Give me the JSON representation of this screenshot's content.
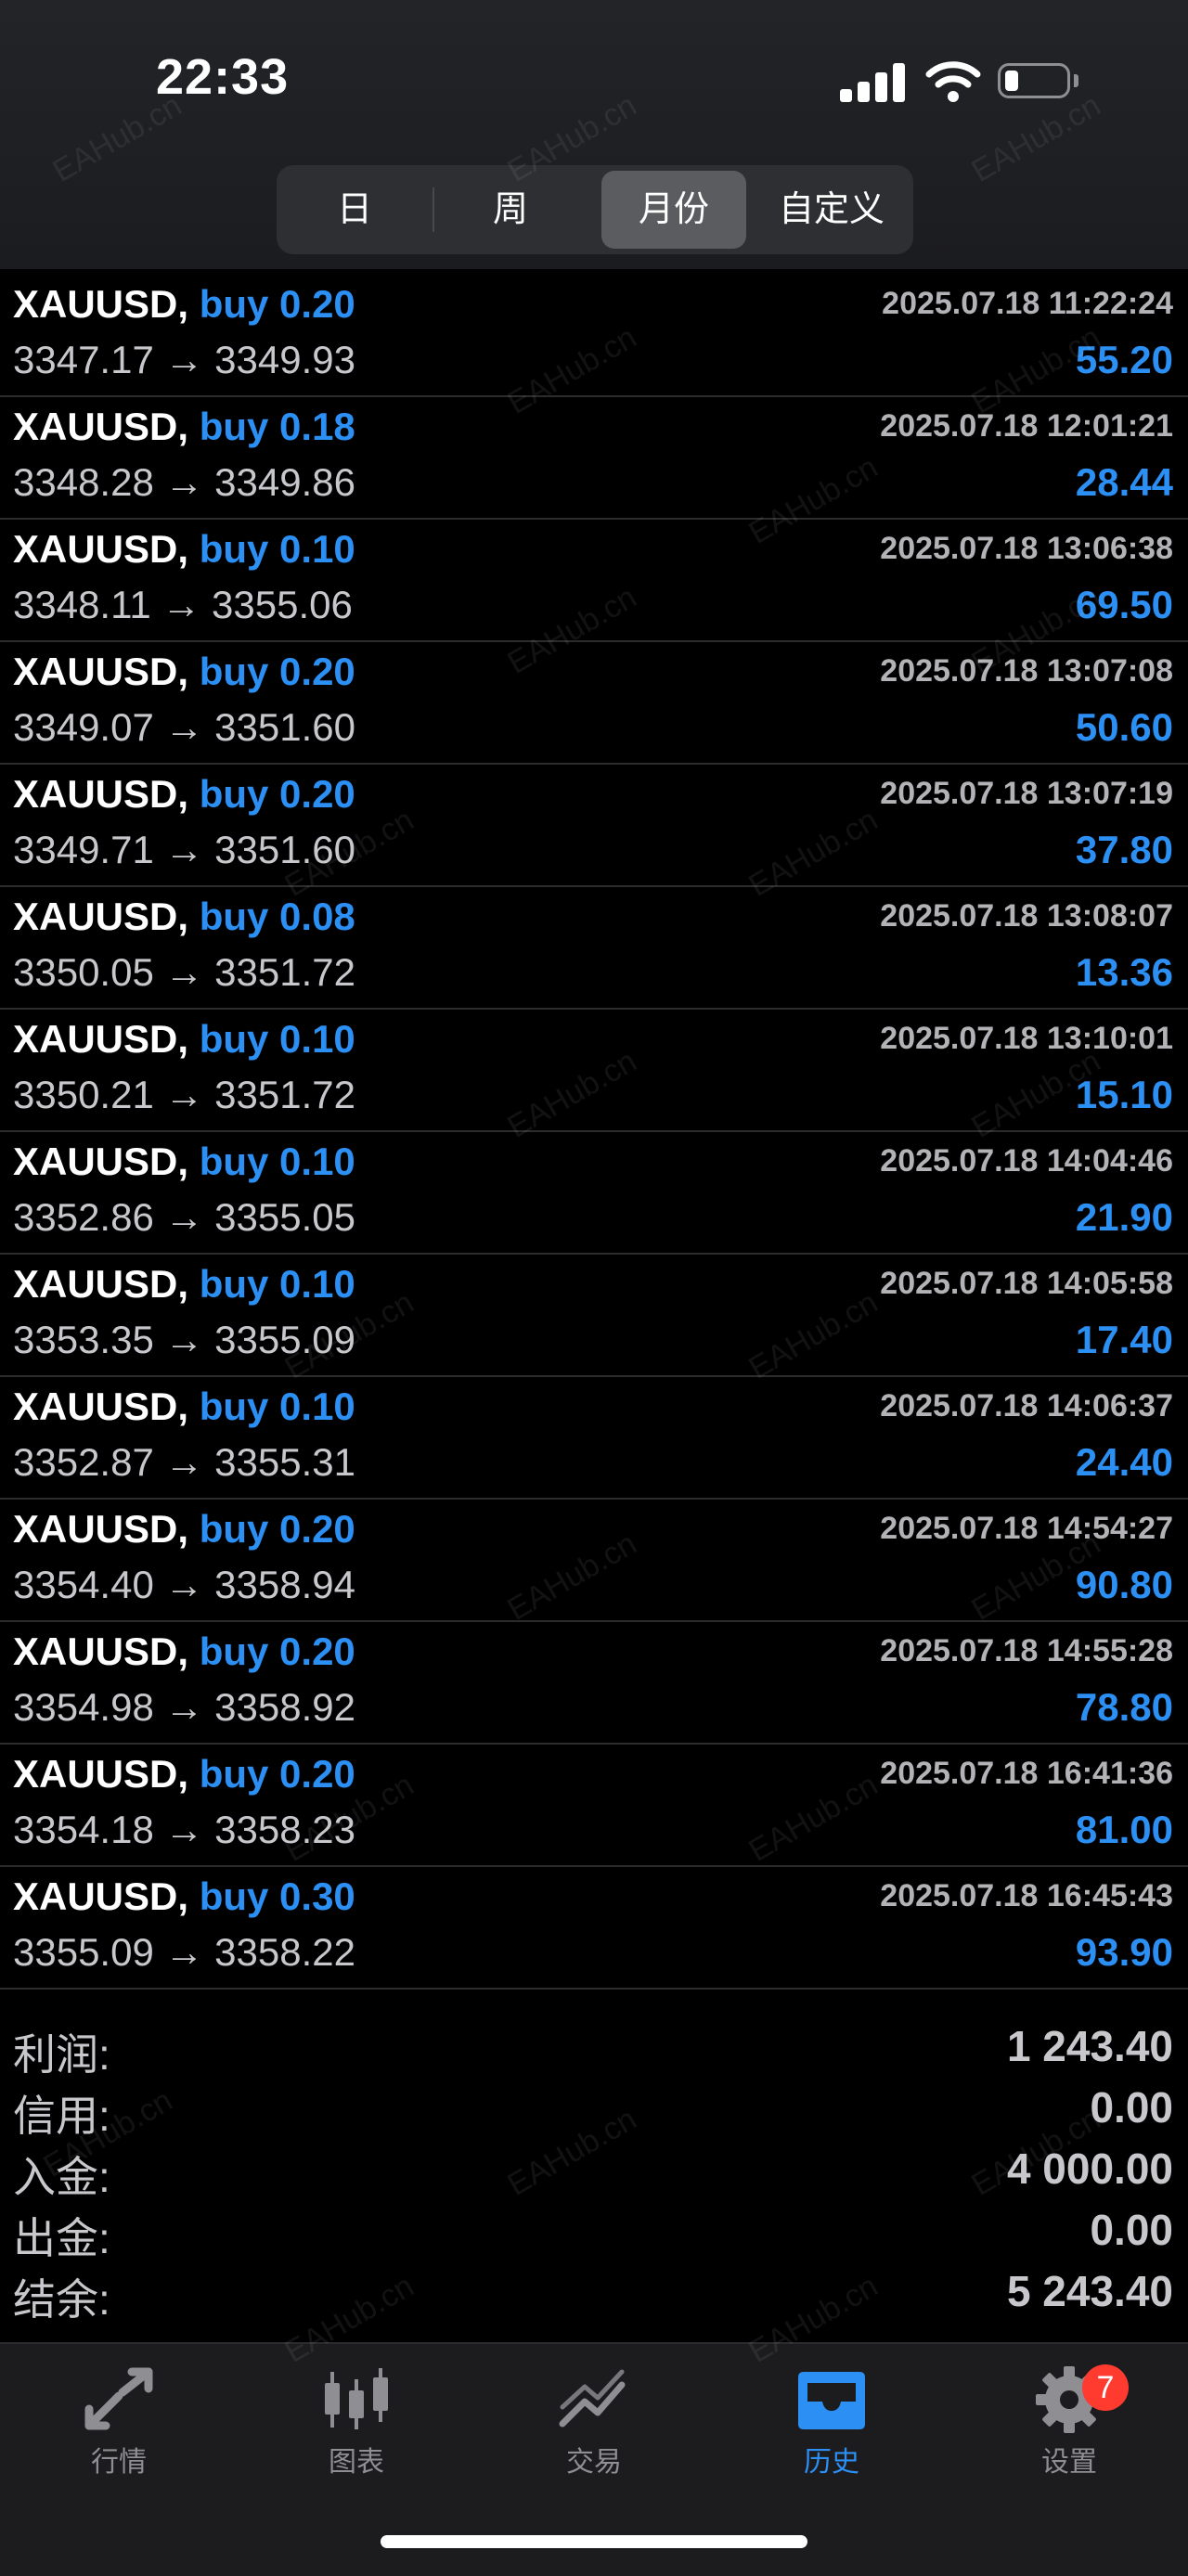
{
  "status_bar": {
    "time": "22:33"
  },
  "segments": [
    {
      "label": "日",
      "active": false
    },
    {
      "label": "周",
      "active": false
    },
    {
      "label": "月份",
      "active": true
    },
    {
      "label": "自定义",
      "active": false
    }
  ],
  "trades": [
    {
      "symbol": "XAUUSD,",
      "side": "buy 0.20",
      "time": "2025.07.18 11:22:24",
      "prices": "3347.17 → 3349.93",
      "profit": "55.20"
    },
    {
      "symbol": "XAUUSD,",
      "side": "buy 0.18",
      "time": "2025.07.18 12:01:21",
      "prices": "3348.28 → 3349.86",
      "profit": "28.44"
    },
    {
      "symbol": "XAUUSD,",
      "side": "buy 0.10",
      "time": "2025.07.18 13:06:38",
      "prices": "3348.11 → 3355.06",
      "profit": "69.50"
    },
    {
      "symbol": "XAUUSD,",
      "side": "buy 0.20",
      "time": "2025.07.18 13:07:08",
      "prices": "3349.07 → 3351.60",
      "profit": "50.60"
    },
    {
      "symbol": "XAUUSD,",
      "side": "buy 0.20",
      "time": "2025.07.18 13:07:19",
      "prices": "3349.71 → 3351.60",
      "profit": "37.80"
    },
    {
      "symbol": "XAUUSD,",
      "side": "buy 0.08",
      "time": "2025.07.18 13:08:07",
      "prices": "3350.05 → 3351.72",
      "profit": "13.36"
    },
    {
      "symbol": "XAUUSD,",
      "side": "buy 0.10",
      "time": "2025.07.18 13:10:01",
      "prices": "3350.21 → 3351.72",
      "profit": "15.10"
    },
    {
      "symbol": "XAUUSD,",
      "side": "buy 0.10",
      "time": "2025.07.18 14:04:46",
      "prices": "3352.86 → 3355.05",
      "profit": "21.90"
    },
    {
      "symbol": "XAUUSD,",
      "side": "buy 0.10",
      "time": "2025.07.18 14:05:58",
      "prices": "3353.35 → 3355.09",
      "profit": "17.40"
    },
    {
      "symbol": "XAUUSD,",
      "side": "buy 0.10",
      "time": "2025.07.18 14:06:37",
      "prices": "3352.87 → 3355.31",
      "profit": "24.40"
    },
    {
      "symbol": "XAUUSD,",
      "side": "buy 0.20",
      "time": "2025.07.18 14:54:27",
      "prices": "3354.40 → 3358.94",
      "profit": "90.80"
    },
    {
      "symbol": "XAUUSD,",
      "side": "buy 0.20",
      "time": "2025.07.18 14:55:28",
      "prices": "3354.98 → 3358.92",
      "profit": "78.80"
    },
    {
      "symbol": "XAUUSD,",
      "side": "buy 0.20",
      "time": "2025.07.18 16:41:36",
      "prices": "3354.18 → 3358.23",
      "profit": "81.00"
    },
    {
      "symbol": "XAUUSD,",
      "side": "buy 0.30",
      "time": "2025.07.18 16:45:43",
      "prices": "3355.09 → 3358.22",
      "profit": "93.90"
    }
  ],
  "summary": [
    {
      "label": "利润:",
      "value": "1 243.40"
    },
    {
      "label": "信用:",
      "value": "0.00"
    },
    {
      "label": "入金:",
      "value": "4 000.00"
    },
    {
      "label": "出金:",
      "value": "0.00"
    },
    {
      "label": "结余:",
      "value": "5 243.40"
    }
  ],
  "tabs": [
    {
      "label": "行情",
      "icon": "quotes-arrows-icon",
      "active": false
    },
    {
      "label": "图表",
      "icon": "candlestick-chart-icon",
      "active": false
    },
    {
      "label": "交易",
      "icon": "trade-trend-icon",
      "active": false
    },
    {
      "label": "历史",
      "icon": "history-inbox-icon",
      "active": true
    },
    {
      "label": "设置",
      "icon": "settings-gear-icon",
      "active": false,
      "badge": "7"
    }
  ],
  "watermark": "EAHub.cn",
  "colors": {
    "accent": "#2c8ff3",
    "background": "#000000",
    "badge": "#ff3b30"
  }
}
